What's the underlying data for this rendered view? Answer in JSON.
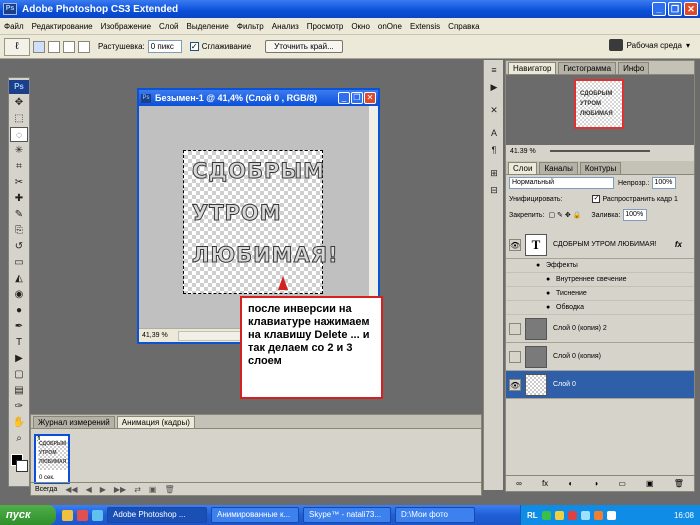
{
  "app": {
    "title": "Adobe Photoshop CS3 Extended",
    "logo": "Ps"
  },
  "window_buttons": {
    "minimize": "_",
    "restore": "❐",
    "close": "✕"
  },
  "menu": [
    "Файл",
    "Редактирование",
    "Изображение",
    "Слой",
    "Выделение",
    "Фильтр",
    "Анализ",
    "Просмотр",
    "Окно",
    "onOne",
    "Extensis",
    "Справка"
  ],
  "options": {
    "feather_label": "Растушевка:",
    "feather_value": "0 пикс",
    "antialias_label": "Сглаживание",
    "refine_button": "Уточнить край...",
    "workspace_label": "Рабочая среда",
    "workspace_arrow": "▾"
  },
  "toolbox": {
    "tools": [
      "move-tool",
      "marquee-tool",
      "lasso-tool",
      "magic-wand-tool",
      "crop-tool",
      "slice-tool",
      "healing-tool",
      "brush-tool",
      "clone-stamp-tool",
      "history-brush-tool",
      "eraser-tool",
      "paint-bucket-tool",
      "blur-tool",
      "dodge-tool",
      "pen-tool",
      "type-tool",
      "path-selection-tool",
      "shape-tool",
      "notes-tool",
      "eyedropper-tool",
      "hand-tool",
      "zoom-tool"
    ],
    "glyphs": [
      "✥",
      "⬚",
      "◌",
      "✳",
      "⌗",
      "✂",
      "✚",
      "✎",
      "⎘",
      "↺",
      "▭",
      "◭",
      "◉",
      "●",
      "✒",
      "T",
      "▶",
      "▢",
      "▤",
      "✑",
      "✋",
      "⌕"
    ]
  },
  "document": {
    "title": "Безымен-1 @ 41,4% (Слой 0 , RGB/8)",
    "zoom": "41,39 %",
    "image_lines": [
      "СДОБРЫМ",
      "УТРОМ",
      "ЛЮБИМАЯ!"
    ]
  },
  "annotation": {
    "text": "после инверсии на клавиатуре нажимаем на клавишу Delete ... и так делаем со 2 и 3 слоем",
    "color": "#d62020"
  },
  "dock_icons": {
    "names": [
      "history-icon",
      "actions-icon",
      "tools-icon",
      "character-icon",
      "paragraph-icon",
      "layer-comps-icon",
      "presets-icon"
    ],
    "glyphs": [
      "≡",
      "▶",
      "✕",
      "A",
      "¶",
      "⊞",
      "⊟"
    ]
  },
  "navigator": {
    "tabs": [
      "Навигатор",
      "Гистограмма",
      "Инфо"
    ],
    "zoom": "41.39 %",
    "thumb_lines": [
      "СДОБРЫМ",
      "УТРОМ",
      "ЛЮБИМАЯ"
    ]
  },
  "layers_panel": {
    "tabs": [
      "Слои",
      "Каналы",
      "Контуры"
    ],
    "blend_mode": "Нормальный",
    "opacity_label": "Непрозр.:",
    "opacity_value": "100%",
    "unify_label": "Унифицировать:",
    "propagate_label": "Распространить кадр 1",
    "lock_label": "Закрепить:",
    "fill_label": "Заливка:",
    "fill_value": "100%",
    "text_layer": {
      "thumb": "T",
      "name": "СДОБРЫМ УТРОМ ЛЮБИМАЯ!",
      "fx": "fx"
    },
    "effects_label": "Эффекты",
    "effects": [
      "Внутреннее свечение",
      "Тиснение",
      "Обводка"
    ],
    "layers": [
      "Слой 0 (копия) 2",
      "Слой 0 (копия)",
      "Слой 0"
    ],
    "footer_icons": [
      "∞",
      "fx",
      "◐",
      "◑",
      "▭",
      "▣",
      "🗑"
    ]
  },
  "animation": {
    "tabs": [
      "Журнал измерений",
      "Анимация (кадры)"
    ],
    "frame_number": "1",
    "frame_time": "0 сек.",
    "frame_lines": [
      "СДОБРЫМ",
      "УТРОМ",
      "ЛЮБИМАЯ"
    ],
    "loop": "Всегда",
    "controls": [
      "◀◀",
      "◀",
      "▶",
      "▶▶",
      "⇄",
      "▣",
      "🗑"
    ]
  },
  "taskbar": {
    "start": "пуск",
    "buttons": [
      "Adobe Photoshop ...",
      "Анимированные к...",
      "Skype™ - natali73...",
      "D:\\Мои фото"
    ],
    "lang": "RL",
    "clock": "16:08"
  },
  "colors": {
    "titlebar": "#0a4fd8",
    "selected_layer": "#2e5fa8",
    "workspace_bg": "#6b6b6b"
  }
}
